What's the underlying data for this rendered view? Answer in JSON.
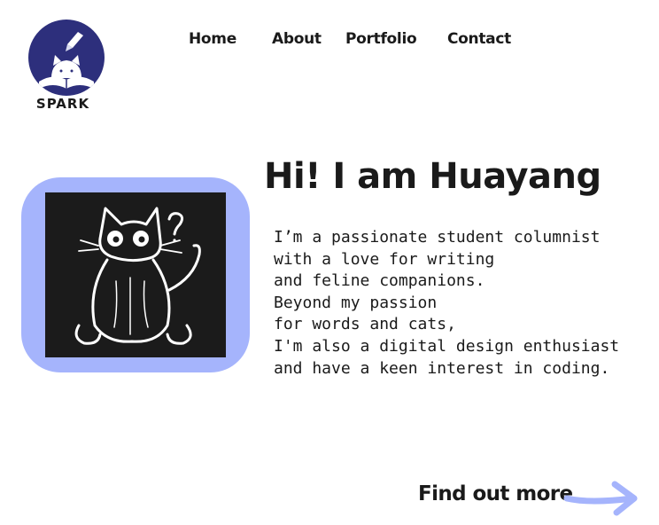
{
  "brand": {
    "name": "SPARK",
    "logo_icon": "spark-logo-icon",
    "logo_color": "#2d2f7c"
  },
  "nav": {
    "items": [
      {
        "label": "Home"
      },
      {
        "label": "About"
      },
      {
        "label": "Portfolio"
      },
      {
        "label": "Contact"
      }
    ]
  },
  "hero": {
    "title": "Hi! I am Huayang",
    "photo_icon": "cat-illustration-icon",
    "frame_color": "#a5b4fc",
    "bio_lines": [
      "I’m a passionate student columnist",
      "with a love for writing",
      "and feline companions.",
      "Beyond my passion",
      "for words and cats,",
      "I'm also a digital design enthusiast",
      "and have a keen interest in coding."
    ]
  },
  "cta": {
    "label": "Find out more",
    "arrow_icon": "arrow-right-icon",
    "arrow_color": "#a5b4fc"
  }
}
